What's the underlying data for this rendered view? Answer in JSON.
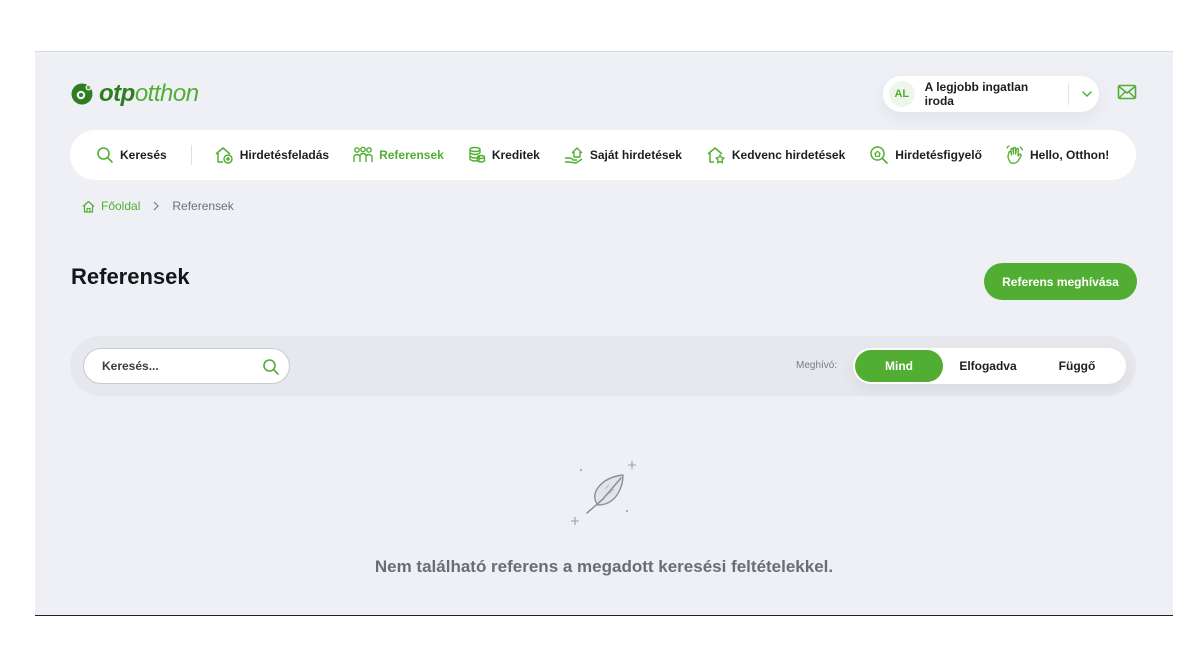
{
  "brand": {
    "logo_otp": "otp",
    "logo_otthon": "otthon",
    "color_primary": "#52ae32",
    "color_dark": "#2e7d1f",
    "icon": "otp-logo-icon"
  },
  "header": {
    "office": {
      "avatar_initials": "AL",
      "name": "A legjobb ingatlan iroda",
      "icon": "chevron-down-icon"
    },
    "mail_icon": "envelope-icon"
  },
  "nav": {
    "items": [
      {
        "label": "Keresés",
        "icon": "search-icon"
      },
      {
        "label": "Hirdetésfeladás",
        "icon": "house-plus-icon"
      },
      {
        "label": "Referensek",
        "icon": "people-icon",
        "active": true
      },
      {
        "label": "Kreditek",
        "icon": "coins-icon"
      },
      {
        "label": "Saját hirdetések",
        "icon": "house-hand-icon"
      },
      {
        "label": "Kedvenc hirdetések",
        "icon": "house-star-icon"
      },
      {
        "label": "Hirdetésfigyelő",
        "icon": "search-house-icon"
      },
      {
        "label": "Hello, Otthon!",
        "icon": "waving-hand-icon"
      }
    ]
  },
  "breadcrumb": {
    "home": "Főoldal",
    "current": "Referensek"
  },
  "page": {
    "title": "Referensek",
    "invite_button": "Referens meghívása"
  },
  "filters": {
    "search_placeholder": "Keresés...",
    "invite_label": "Meghívó:",
    "options": [
      "Mind",
      "Elfogadva",
      "Függő"
    ],
    "selected": "Mind"
  },
  "empty_state": {
    "icon": "feather-icon",
    "message": "Nem található referens a megadott keresési feltételekkel."
  }
}
